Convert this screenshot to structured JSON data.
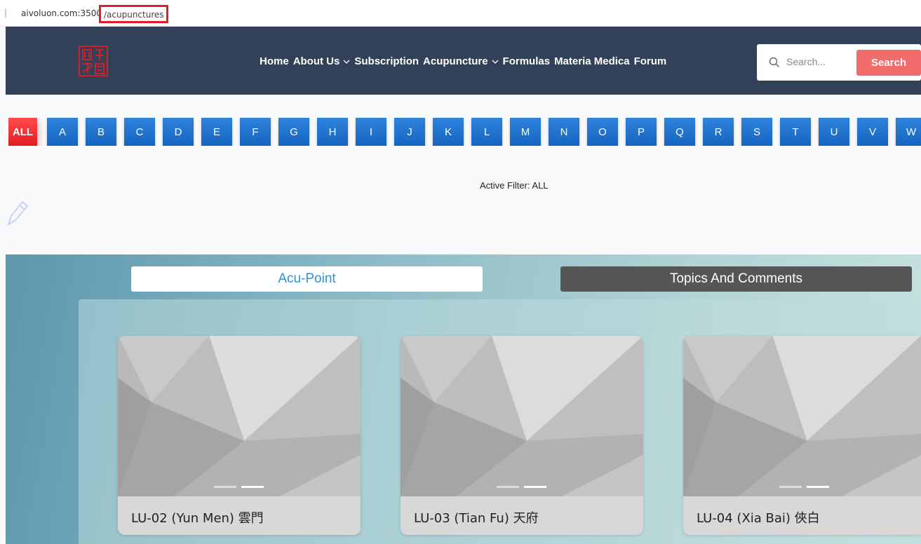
{
  "browser": {
    "separator": "|",
    "host": "aivoluon.com:3500",
    "path": "/acupunctures"
  },
  "header": {
    "logo_icon": "chinese-seal-logo-icon",
    "nav": [
      {
        "label": "Home",
        "dropdown": false
      },
      {
        "label": "About Us",
        "dropdown": true
      },
      {
        "label": "Subscription",
        "dropdown": false
      },
      {
        "label": "Acupuncture",
        "dropdown": true
      },
      {
        "label": "Formulas",
        "dropdown": false
      },
      {
        "label": "Materia Medica",
        "dropdown": false
      },
      {
        "label": "Forum",
        "dropdown": false
      }
    ],
    "search": {
      "placeholder": "Search...",
      "button_label": "Search"
    }
  },
  "filter": {
    "letters": [
      "ALL",
      "A",
      "B",
      "C",
      "D",
      "E",
      "F",
      "G",
      "H",
      "I",
      "J",
      "K",
      "L",
      "M",
      "N",
      "O",
      "P",
      "Q",
      "R",
      "S",
      "T",
      "U",
      "V",
      "W"
    ],
    "active_label": "Active Filter: ALL"
  },
  "tabs": [
    {
      "label": "Acu-Point",
      "active": true
    },
    {
      "label": "Topics And Comments",
      "active": false
    }
  ],
  "cards": [
    {
      "title": "LU-02 (Yun Men) 雲門"
    },
    {
      "title": "LU-03 (Tian Fu) 天府"
    },
    {
      "title": "LU-04 (Xia Bai) 俠白"
    }
  ],
  "colors": {
    "header_bg": "#324058",
    "letter_blue": "#1e74d2",
    "all_red": "#e31b23",
    "search_button": "#f26c6c",
    "tab_active_text": "#2a93d5"
  }
}
